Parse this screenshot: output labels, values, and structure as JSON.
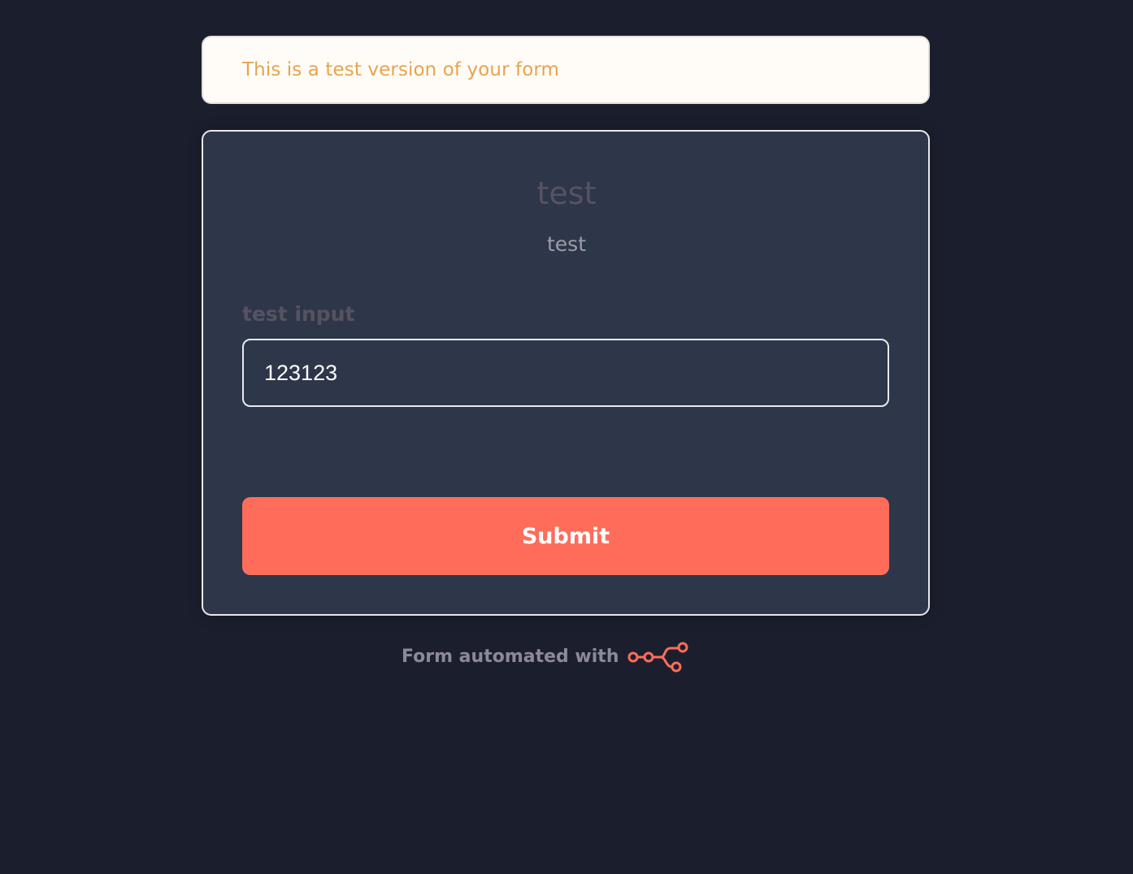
{
  "banner": {
    "text": "This is a test version of your form"
  },
  "form": {
    "title": "test",
    "subtitle": "test",
    "field": {
      "label": "test input",
      "value": "123123"
    },
    "submit_label": "Submit"
  },
  "footer": {
    "text": "Form automated with",
    "logo_icon": "n8n-logo-icon"
  },
  "colors": {
    "background": "#1b1f2d",
    "card": "#2e3649",
    "accent": "#ff6d5a",
    "banner_text": "#e6a44e"
  }
}
